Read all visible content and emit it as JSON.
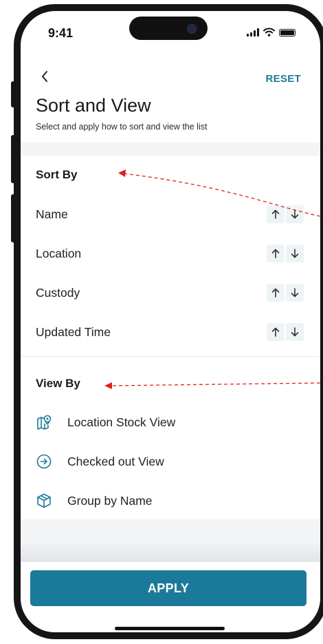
{
  "status_bar": {
    "time": "9:41"
  },
  "header": {
    "back_icon": "chevron-left-icon",
    "reset_label": "RESET",
    "title": "Sort and View",
    "subtitle": "Select and apply how to sort and view the list"
  },
  "sort": {
    "title": "Sort By",
    "items": [
      {
        "label": "Name"
      },
      {
        "label": "Location"
      },
      {
        "label": "Custody"
      },
      {
        "label": "Updated Time"
      }
    ],
    "up_icon": "arrow-up-icon",
    "down_icon": "arrow-down-icon"
  },
  "view": {
    "title": "View By",
    "items": [
      {
        "label": "Location Stock View",
        "icon": "map-pin-icon"
      },
      {
        "label": "Checked out View",
        "icon": "arrow-circle-icon"
      },
      {
        "label": "Group by Name",
        "icon": "box-icon"
      }
    ]
  },
  "footer": {
    "apply_label": "APPLY"
  },
  "colors": {
    "accent": "#1b7a99",
    "band": "#f3f4f6",
    "arrow_bg": "#eef4f6",
    "annotation": "#e0201b"
  }
}
